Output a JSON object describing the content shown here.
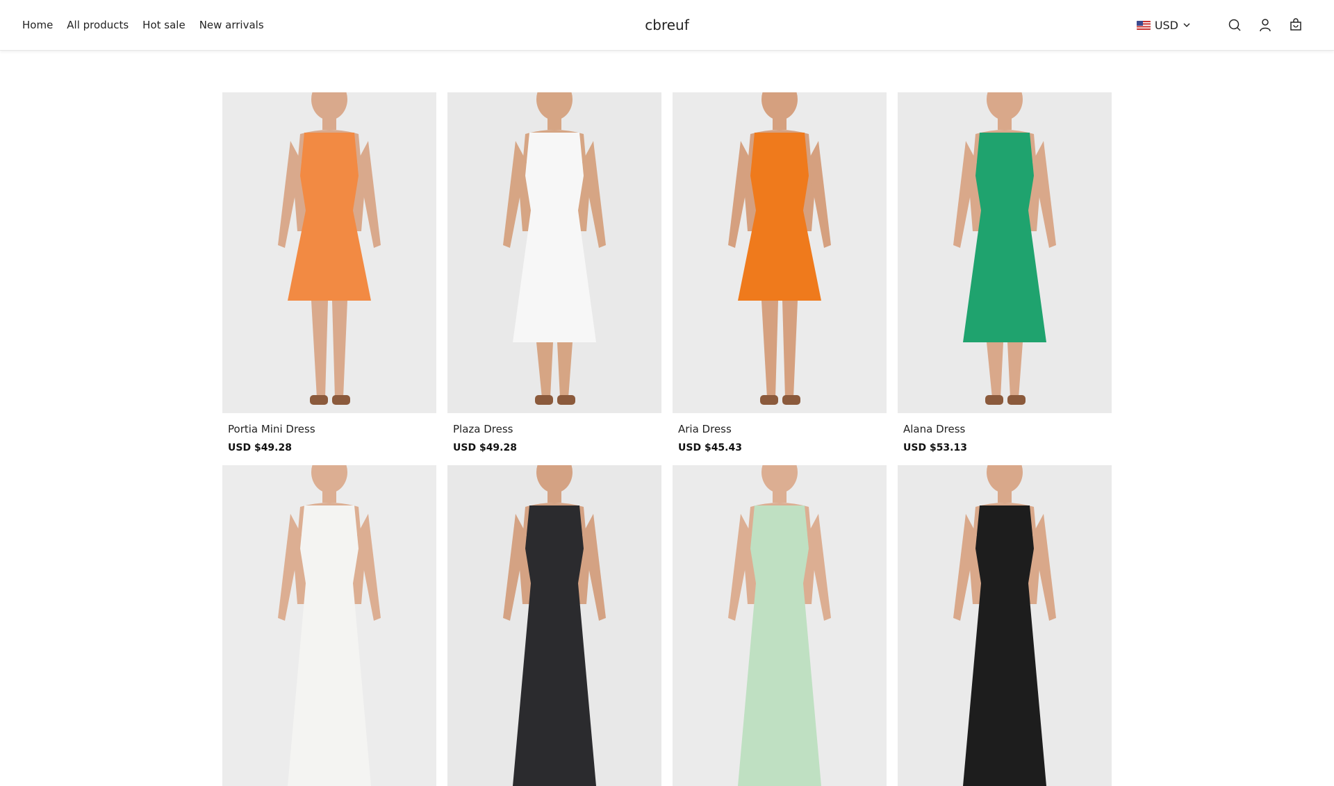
{
  "nav": {
    "items": [
      "Home",
      "All products",
      "Hot sale",
      "New arrivals"
    ]
  },
  "logo": "cbreuf",
  "currency": {
    "label": "USD",
    "flag": "us-flag-icon"
  },
  "icons": [
    "search-icon",
    "account-icon",
    "cart-icon"
  ],
  "products": [
    {
      "name": "Portia Mini Dress",
      "price": "USD $49.28",
      "dress": "#f28a43",
      "skin": "#d9a98c",
      "bg": "#ebebeb",
      "length": "mini"
    },
    {
      "name": "Plaza Dress",
      "price": "USD $49.28",
      "dress": "#f7f7f7",
      "skin": "#d6a584",
      "bg": "#e9e9e9",
      "length": "midi"
    },
    {
      "name": "Aria Dress",
      "price": "USD $45.43",
      "dress": "#ef7a1c",
      "skin": "#d5a07f",
      "bg": "#ebebeb",
      "length": "mini"
    },
    {
      "name": "Alana Dress",
      "price": "USD $53.13",
      "dress": "#1fa36e",
      "skin": "#d9a88a",
      "bg": "#eaeaea",
      "length": "midi"
    },
    {
      "name": "",
      "price": "",
      "dress": "#f4f4f2",
      "skin": "#dcae92",
      "bg": "#ececec",
      "length": "maxi"
    },
    {
      "name": "",
      "price": "",
      "dress": "#2b2b2e",
      "skin": "#d4a283",
      "bg": "#e8e8e8",
      "length": "maxi"
    },
    {
      "name": "",
      "price": "",
      "dress": "#bfe0c2",
      "skin": "#dcae92",
      "bg": "#ebebeb",
      "length": "maxi"
    },
    {
      "name": "",
      "price": "",
      "dress": "#1d1d1d",
      "skin": "#d9a88a",
      "bg": "#eaeaea",
      "length": "maxi"
    }
  ],
  "colors": {
    "accent": "#222222",
    "border": "#e6e6e6"
  }
}
